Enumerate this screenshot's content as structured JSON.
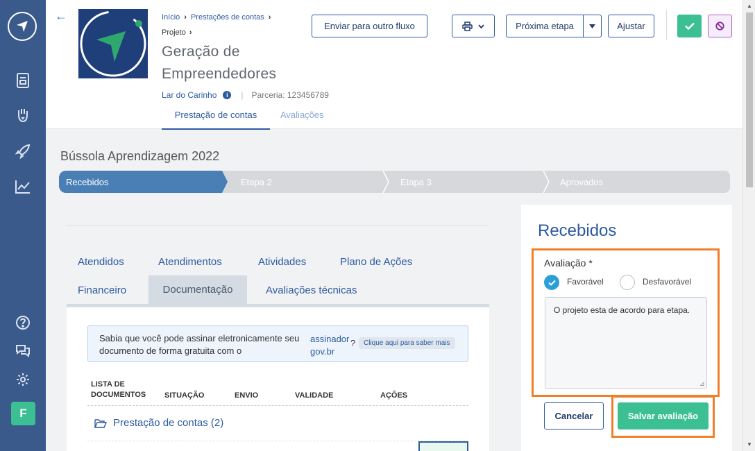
{
  "sidebar": {
    "avatar_letter": "F",
    "icons": [
      "logo-icon",
      "document-icon",
      "hand-heart-icon",
      "rocket-icon",
      "chart-icon",
      "help-icon",
      "chat-icon",
      "gear-icon"
    ]
  },
  "header": {
    "breadcrumb": [
      "Início",
      "Prestações de contas"
    ],
    "breadcrumb_sub": "Projeto",
    "project_title": "Geração de Empreendedores",
    "org_name": "Lar do Carinho",
    "partnership": "Parceria: 123456789",
    "tabs": [
      {
        "label": "Prestação de contas",
        "active": true
      },
      {
        "label": "Avaliações",
        "active": false
      }
    ],
    "buttons": {
      "send_flow": "Enviar para outro fluxo",
      "next_step": "Próxima etapa",
      "adjust": "Ajustar"
    }
  },
  "main": {
    "section_title": "Bússola Aprendizagem 2022",
    "steps": [
      {
        "label": "Recebidos",
        "active": true
      },
      {
        "label": "Etapa 2",
        "active": false
      },
      {
        "label": "Etapa 3",
        "active": false
      },
      {
        "label": "Aprovados",
        "active": false
      }
    ],
    "tabs_row1": [
      "Atendidos",
      "Atendimentos",
      "Atividades",
      "Plano de Ações"
    ],
    "tabs_row2": [
      "Financeiro",
      "Documentação",
      "Avaliações técnicas"
    ],
    "active_tab": "Documentação",
    "alert": {
      "line1": "Sabia que você pode assinar eletronicamente seu",
      "line2": "documento de forma gratuita com o",
      "link": "assinador gov.br",
      "question": "?",
      "cta": "Clique aqui para saber mais"
    },
    "table": {
      "headers": [
        "LISTA DE DOCUMENTOS",
        "SITUAÇÃO",
        "ENVIO",
        "VALIDADE",
        "AÇÕES"
      ],
      "folder": "Prestação de contas (2)"
    }
  },
  "evaluation": {
    "title": "Recebidos",
    "label": "Avaliação *",
    "options": [
      "Favorável",
      "Desfavorável"
    ],
    "selected": "Favorável",
    "comment": "O projeto esta de acordo para etapa.",
    "cancel": "Cancelar",
    "save": "Salvar avaliação"
  },
  "colors": {
    "sidebar": "#3a5a8c",
    "primary": "#2d5aa0",
    "success": "#3dbf94",
    "highlight": "#f07f2a",
    "step_active": "#4a7fb5",
    "step_inactive": "#d6d8db"
  }
}
